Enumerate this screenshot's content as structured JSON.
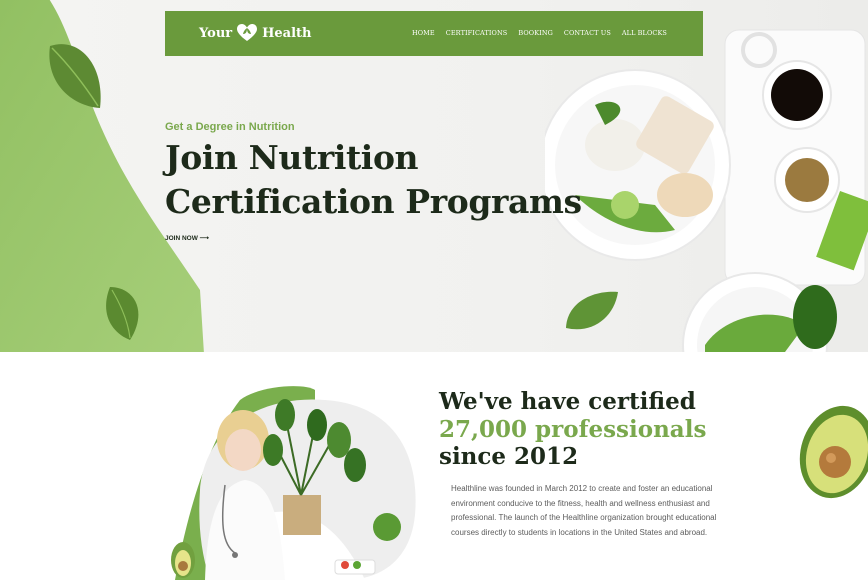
{
  "nav": {
    "logo_left": "Your",
    "logo_right": "Health",
    "links": [
      "HOME",
      "CERTIFICATIONS",
      "BOOKING",
      "CONTACT US",
      "ALL BLOCKS"
    ]
  },
  "hero": {
    "eyebrow": "Get a Degree in Nutrition",
    "title_line1": "Join Nutrition",
    "title_line2": "Certification Programs",
    "cta": "JOIN NOW ⟶"
  },
  "stats": {
    "line1": "We've have certified",
    "line2": "27,000 professionals",
    "line3": "since 2012",
    "body": "Healthline was founded in March 2012 to create and foster an educational environment conducive to the fitness, health and wellness enthusiast and professional. The launch of the Healthline organization brought educational courses directly to students in locations in the United States and abroad."
  },
  "colors": {
    "brand_green": "#6a9a3c",
    "accent_green": "#7aa84d",
    "heading_dark": "#1d2a1a"
  }
}
